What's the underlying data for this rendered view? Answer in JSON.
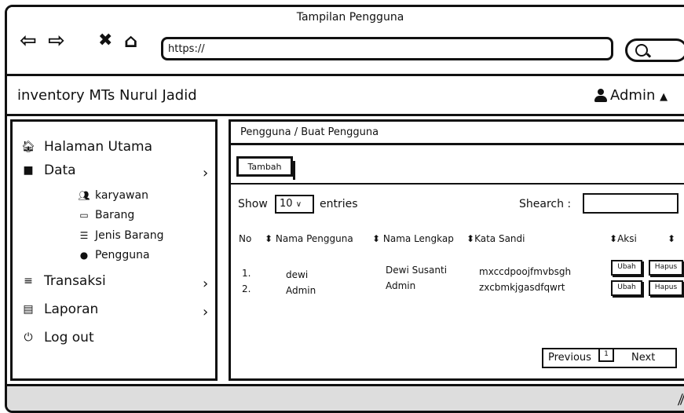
{
  "window": {
    "title": "Tampilan Pengguna"
  },
  "browser": {
    "url": "https://"
  },
  "app": {
    "name": "inventory MTs Nurul Jadid",
    "user": "Admin"
  },
  "sidebar": {
    "items": [
      {
        "label": "Halaman Utama",
        "icon": "home-icon"
      },
      {
        "label": "Data",
        "icon": "folder-icon"
      },
      {
        "label": "karyawan",
        "icon": "users-icon"
      },
      {
        "label": "Barang",
        "icon": "laptop-icon"
      },
      {
        "label": "Jenis Barang",
        "icon": "list-icon"
      },
      {
        "label": "Pengguna",
        "icon": "user-icon"
      },
      {
        "label": "Transaksi",
        "icon": "menu-icon"
      },
      {
        "label": "Laporan",
        "icon": "file-icon"
      },
      {
        "label": "Log out",
        "icon": "power-icon"
      }
    ]
  },
  "main": {
    "breadcrumb": "Pengguna / Buat Pengguna",
    "add_button": "Tambah",
    "show_label": "Show",
    "entries_value": "10",
    "entries_label": "entries",
    "search_label": "Shearch :",
    "columns": [
      "No",
      "Nama Pengguna",
      "Nama Lengkap",
      "Kata Sandi",
      "Aksi"
    ],
    "rows": [
      {
        "no": "1.",
        "username": "dewi",
        "fullname": "Dewi Susanti",
        "password": "mxccdpoojfmvbsgh",
        "edit": "Ubah",
        "delete": "Hapus"
      },
      {
        "no": "2.",
        "username": "Admin",
        "fullname": "Admin",
        "password": "zxcbmkjgasdfqwrt",
        "edit": "Ubah",
        "delete": "Hapus"
      }
    ],
    "pagination": {
      "prev": "Previous",
      "page": "1",
      "next": "Next"
    }
  }
}
